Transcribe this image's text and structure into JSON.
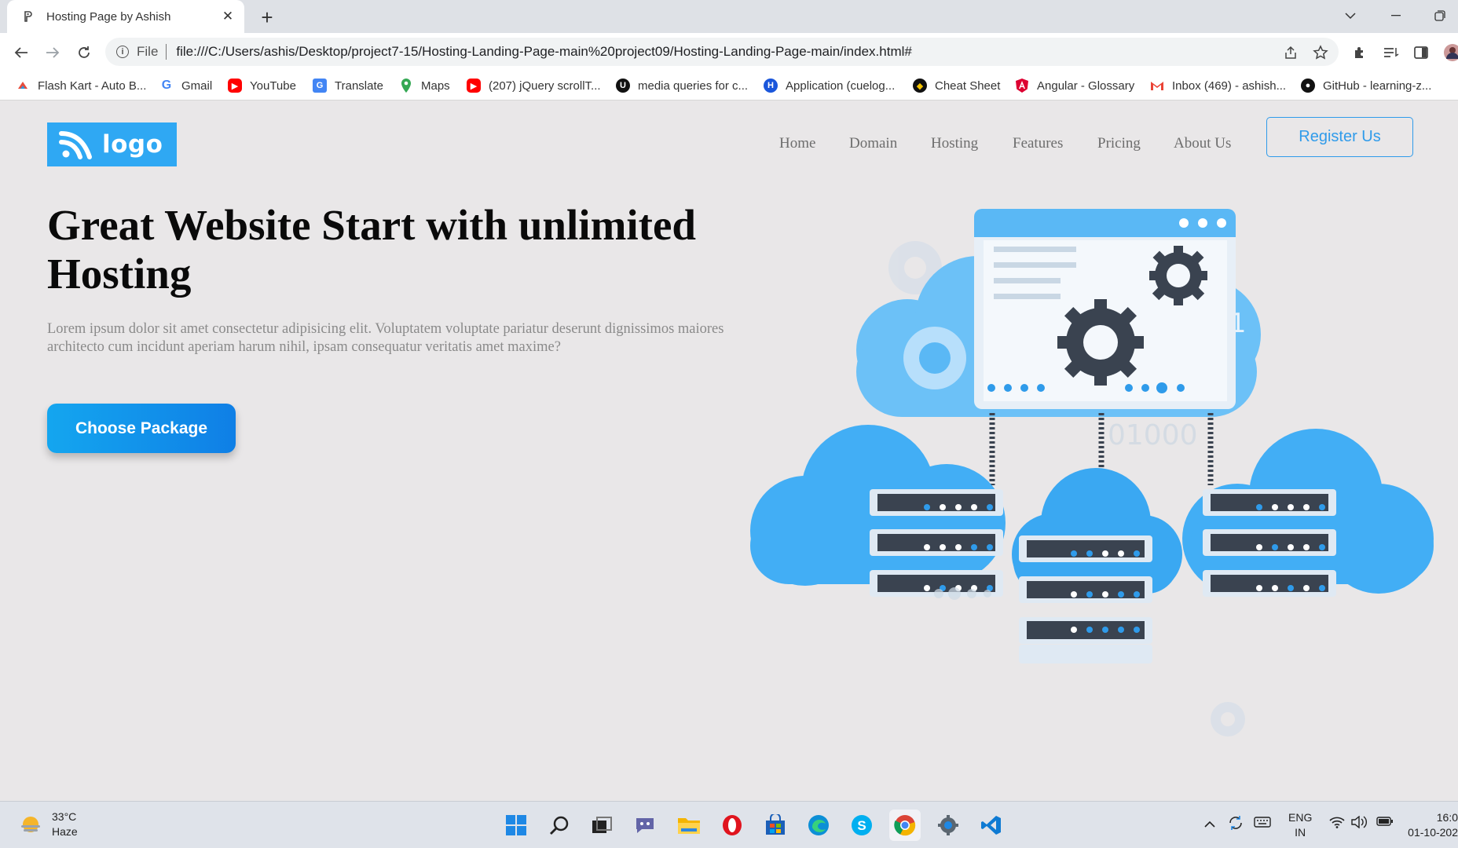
{
  "browser": {
    "tab_title": "Hosting Page by Ashish",
    "scheme_label": "File",
    "url": "file:///C:/Users/ashis/Desktop/project7-15/Hosting-Landing-Page-main%20project09/Hosting-Landing-Page-main/index.html#",
    "bookmarks": [
      {
        "label": "Flash Kart - Auto B...",
        "icon": "flashkart-icon",
        "color": "#e74c3c"
      },
      {
        "label": "Gmail",
        "icon": "google-icon",
        "color": "#4285f4"
      },
      {
        "label": "YouTube",
        "icon": "youtube-icon",
        "color": "#ff0000"
      },
      {
        "label": "Translate",
        "icon": "translate-icon",
        "color": "#4285f4"
      },
      {
        "label": "Maps",
        "icon": "maps-icon",
        "color": "#34a853"
      },
      {
        "label": "(207) jQuery scrollT...",
        "icon": "youtube-icon",
        "color": "#ff0000"
      },
      {
        "label": "media queries for c...",
        "icon": "udemy-icon",
        "color": "#111111"
      },
      {
        "label": "Application (cuelog...",
        "icon": "application-icon",
        "color": "#1a56db"
      },
      {
        "label": "Cheat Sheet",
        "icon": "cheatsheet-icon",
        "color": "#111111"
      },
      {
        "label": "Angular - Glossary",
        "icon": "angular-icon",
        "color": "#dd0031"
      },
      {
        "label": "Inbox (469) - ashish...",
        "icon": "gmail-icon",
        "color": "#ea4335"
      },
      {
        "label": "GitHub - learning-z...",
        "icon": "github-icon",
        "color": "#111111"
      }
    ]
  },
  "site": {
    "logo_text": "logo",
    "nav": [
      "Home",
      "Domain",
      "Hosting",
      "Features",
      "Pricing",
      "About Us"
    ],
    "register_label": "Register Us",
    "hero_title": "Great Website Start with unlimited Hosting",
    "hero_text": "Lorem ipsum dolor sit amet consectetur adipisicing elit. Voluptatem voluptate pariatur deserunt dignissimos maiores architecto cum incidunt aperiam harum nihil, ipsam consequatur veritatis amet maxime?",
    "cta_label": "Choose Package",
    "illustration_text": "0101",
    "illustration_faint_text": "01000",
    "colors": {
      "accent": "#2fa8f3",
      "cloud": "#5ab8f5",
      "server": "#3a4350",
      "bg": "#e9e7e8"
    }
  },
  "taskbar": {
    "temperature": "33°C",
    "condition": "Haze",
    "lang_top": "ENG",
    "lang_bottom": "IN",
    "time": "16:0",
    "date": "01-10-202",
    "apps": [
      "windows-start-icon",
      "search-icon",
      "task-view-icon",
      "teams-chat-icon",
      "file-explorer-icon",
      "opera-icon",
      "store-icon",
      "edge-icon",
      "skype-icon",
      "chrome-icon",
      "settings-icon",
      "vscode-icon"
    ]
  }
}
